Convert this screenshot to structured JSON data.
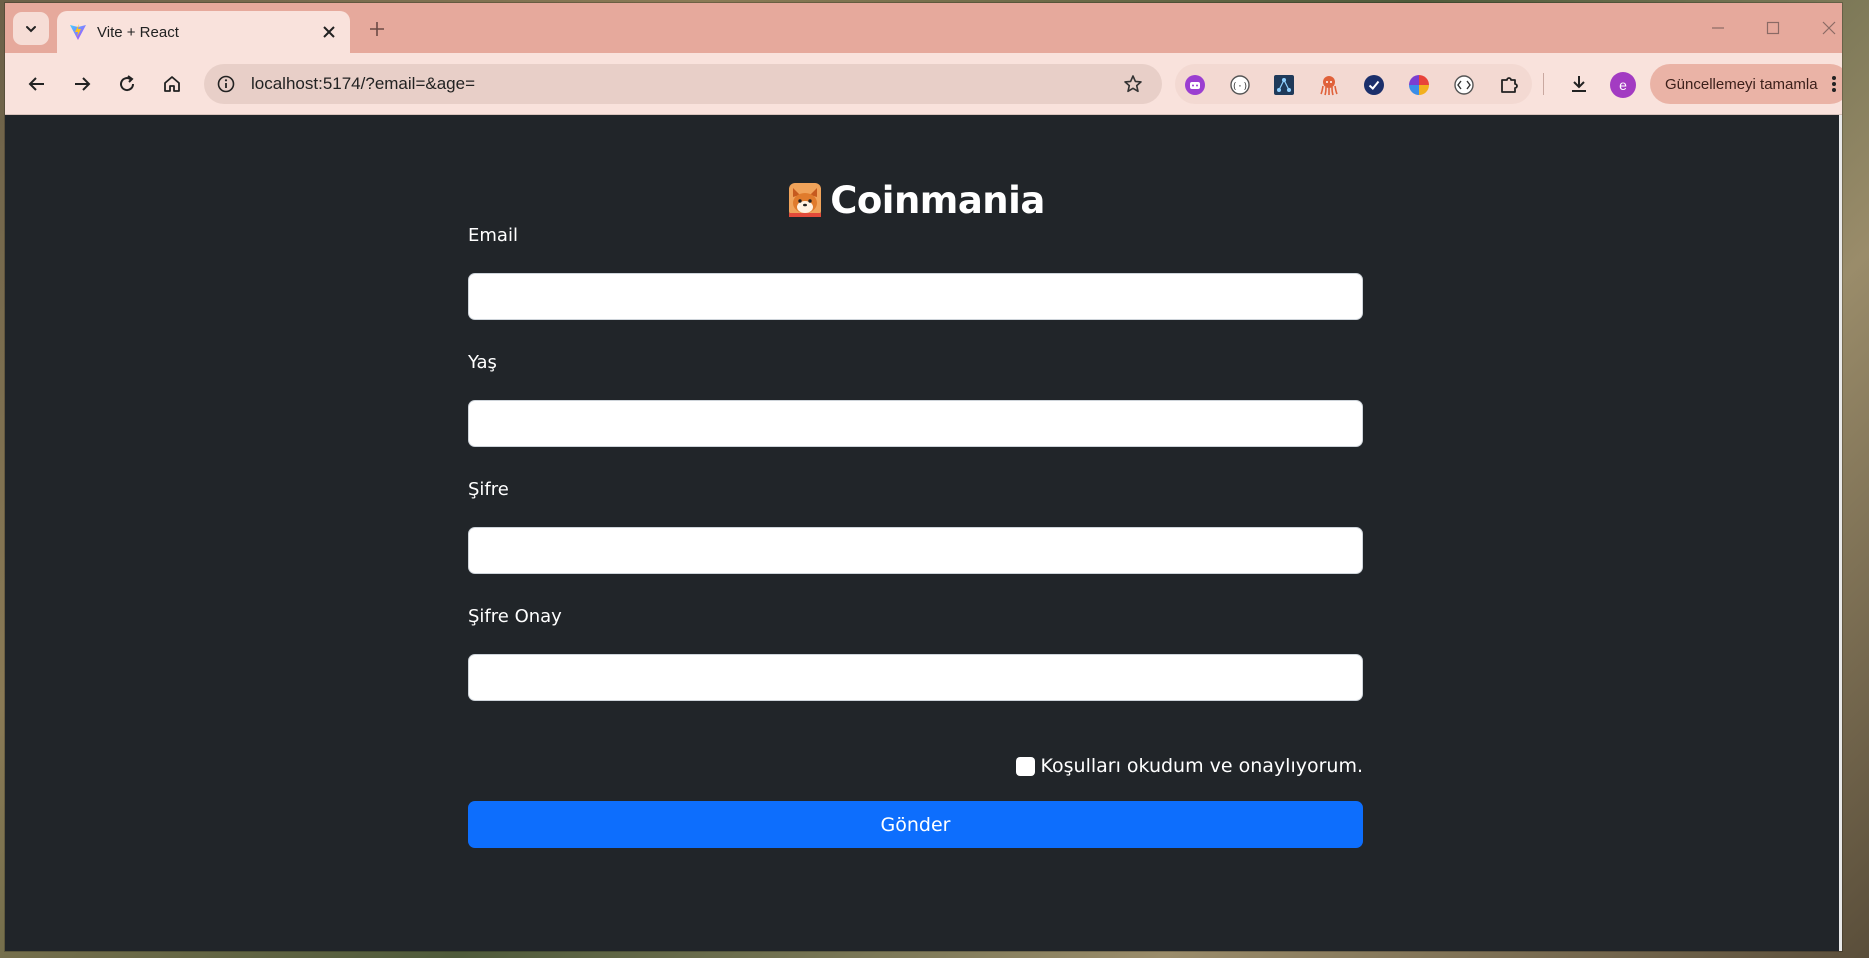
{
  "browser": {
    "tab": {
      "title": "Vite + React",
      "favicon": "vite-icon",
      "close_icon": "close-icon"
    },
    "new_tab_icon": "plus-icon",
    "address_bar": {
      "url": "localhost:5174/?email=&age="
    },
    "update_button": {
      "label": "Güncellemeyi tamamla"
    },
    "profile": {
      "initial": "e",
      "color": "#a33bc2"
    },
    "theme": {
      "frame": "#e6a99c",
      "toolbar": "#f9e2dc"
    }
  },
  "page": {
    "brand": {
      "name": "Coinmania",
      "logo": "shiba-inu-logo"
    },
    "fields": [
      {
        "label": "Email",
        "value": ""
      },
      {
        "label": "Yaş",
        "value": ""
      },
      {
        "label": "Şifre",
        "value": ""
      },
      {
        "label": "Şifre Onay",
        "value": ""
      }
    ],
    "terms": {
      "label": "Koşulları okudum ve onaylıyorum.",
      "checked": false
    },
    "submit": {
      "label": "Gönder",
      "color": "#0d6efd"
    },
    "background": "#212529"
  }
}
